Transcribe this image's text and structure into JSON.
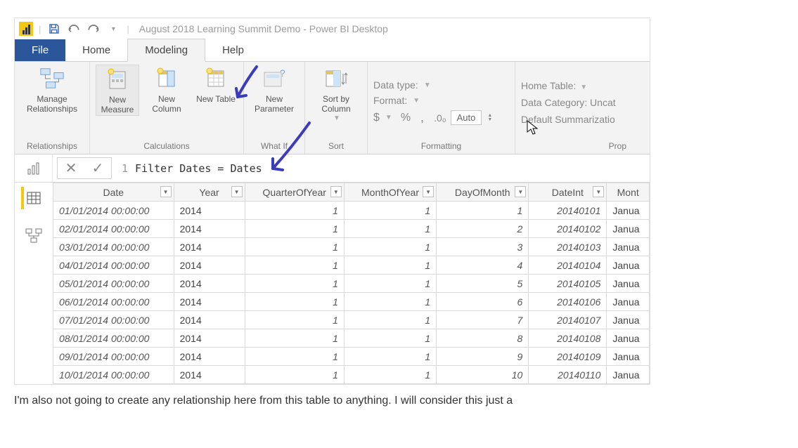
{
  "titlebar": {
    "caption": "August 2018 Learning Summit Demo - Power BI Desktop"
  },
  "tabs": {
    "file": "File",
    "home": "Home",
    "modeling": "Modeling",
    "help": "Help"
  },
  "ribbon": {
    "relationships": {
      "manage": "Manage Relationships",
      "group": "Relationships"
    },
    "calculations": {
      "new_measure": "New Measure",
      "new_column": "New Column",
      "new_table": "New Table",
      "group": "Calculations"
    },
    "whatif": {
      "new_parameter": "New Parameter",
      "group": "What If"
    },
    "sort": {
      "sort_by_column": "Sort by Column",
      "group": "Sort"
    },
    "formatting": {
      "data_type": "Data type:",
      "format": "Format:",
      "currency": "$",
      "percent": "%",
      "comma": ",",
      "decimal": ".0₀",
      "auto": "Auto",
      "group": "Formatting"
    },
    "properties": {
      "home_table": "Home Table:",
      "data_category": "Data Category: Uncat",
      "default_summarization": "Default Summarizatio",
      "group": "Prop"
    }
  },
  "formula": {
    "line": "1",
    "text": "Filter Dates = Dates"
  },
  "grid": {
    "columns": [
      "Date",
      "Year",
      "QuarterOfYear",
      "MonthOfYear",
      "DayOfMonth",
      "DateInt",
      "Mont"
    ],
    "rows": [
      {
        "date": "01/01/2014 00:00:00",
        "year": "2014",
        "q": "1",
        "m": "1",
        "d": "1",
        "di": "20140101",
        "mn": "Janua"
      },
      {
        "date": "02/01/2014 00:00:00",
        "year": "2014",
        "q": "1",
        "m": "1",
        "d": "2",
        "di": "20140102",
        "mn": "Janua"
      },
      {
        "date": "03/01/2014 00:00:00",
        "year": "2014",
        "q": "1",
        "m": "1",
        "d": "3",
        "di": "20140103",
        "mn": "Janua"
      },
      {
        "date": "04/01/2014 00:00:00",
        "year": "2014",
        "q": "1",
        "m": "1",
        "d": "4",
        "di": "20140104",
        "mn": "Janua"
      },
      {
        "date": "05/01/2014 00:00:00",
        "year": "2014",
        "q": "1",
        "m": "1",
        "d": "5",
        "di": "20140105",
        "mn": "Janua"
      },
      {
        "date": "06/01/2014 00:00:00",
        "year": "2014",
        "q": "1",
        "m": "1",
        "d": "6",
        "di": "20140106",
        "mn": "Janua"
      },
      {
        "date": "07/01/2014 00:00:00",
        "year": "2014",
        "q": "1",
        "m": "1",
        "d": "7",
        "di": "20140107",
        "mn": "Janua"
      },
      {
        "date": "08/01/2014 00:00:00",
        "year": "2014",
        "q": "1",
        "m": "1",
        "d": "8",
        "di": "20140108",
        "mn": "Janua"
      },
      {
        "date": "09/01/2014 00:00:00",
        "year": "2014",
        "q": "1",
        "m": "1",
        "d": "9",
        "di": "20140109",
        "mn": "Janua"
      },
      {
        "date": "10/01/2014 00:00:00",
        "year": "2014",
        "q": "1",
        "m": "1",
        "d": "10",
        "di": "20140110",
        "mn": "Janua"
      }
    ]
  },
  "article_bottom": "I'm also not going to create any relationship here from this table to anything. I will consider this just a"
}
